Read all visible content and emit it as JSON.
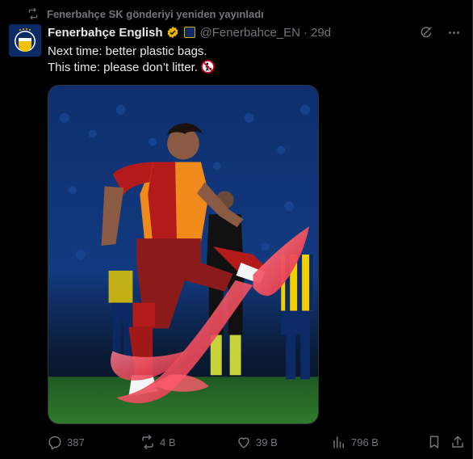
{
  "repost": {
    "icon": "repost-icon",
    "text": "Fenerbahçe SK gönderiyi yeniden yayınladı"
  },
  "author": {
    "name": "Fenerbahçe English",
    "handle": "@Fenerbahce_EN",
    "time": "29d",
    "verified_color": "#e8b500"
  },
  "tweet": {
    "line1": "Next time: better plastic bags.",
    "line2": "This time: please don’t litter."
  },
  "actions": {
    "replies": "387",
    "reposts": "4 B",
    "likes": "39 B",
    "views": "796 B"
  },
  "colors": {
    "background": "#000000",
    "text": "#e7e9ea",
    "muted": "#71767b",
    "border": "#2f3336"
  }
}
